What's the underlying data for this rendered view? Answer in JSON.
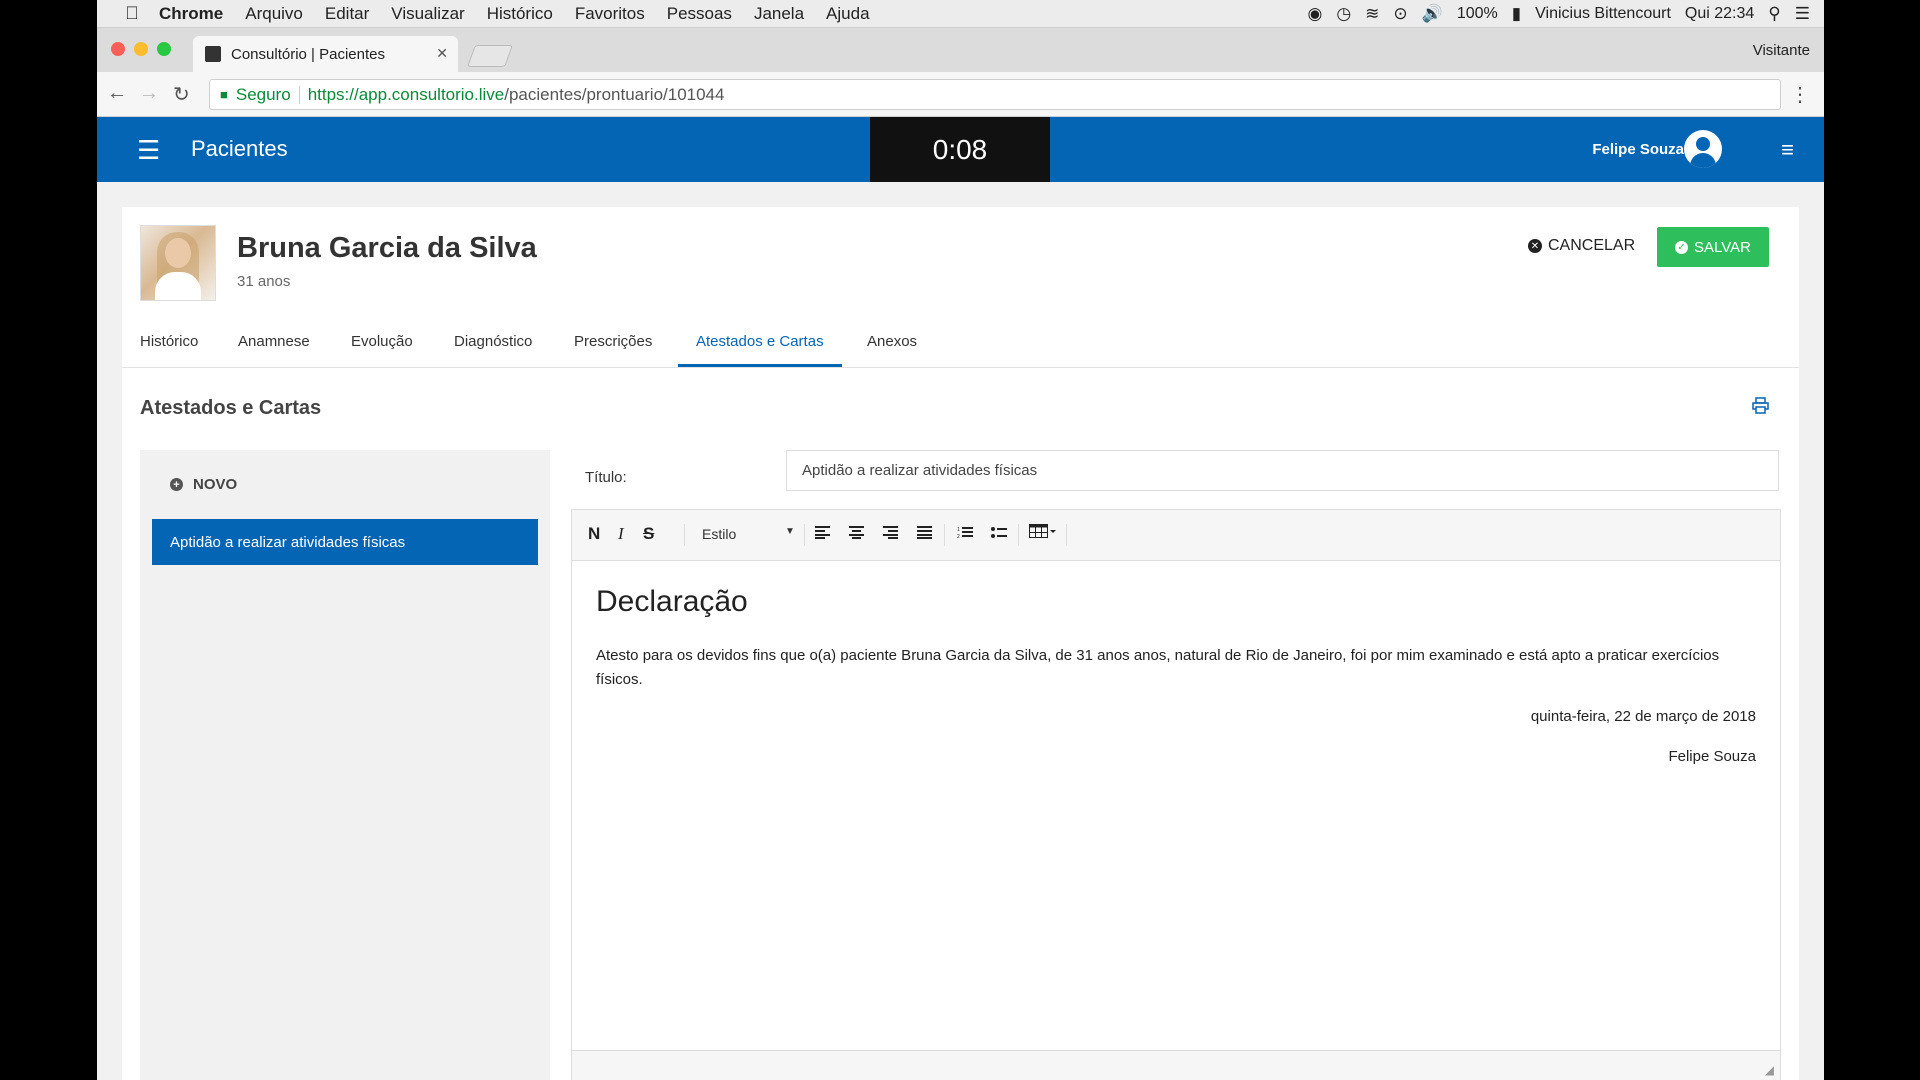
{
  "menubar": {
    "app": "Chrome",
    "items": [
      "Arquivo",
      "Editar",
      "Visualizar",
      "Histórico",
      "Favoritos",
      "Pessoas",
      "Janela",
      "Ajuda"
    ],
    "battery": "100%",
    "user": "Vinicius Bittencourt",
    "clock": "Qui 22:34"
  },
  "browser": {
    "tab_title": "Consultório | Pacientes",
    "profile": "Visitante",
    "secure_label": "Seguro",
    "url_host": "https://app.consultorio.live",
    "url_path": "/pacientes/prontuario/101044"
  },
  "app": {
    "section": "Pacientes",
    "timer": "0:08",
    "user_name": "Felipe Souza"
  },
  "patient": {
    "name": "Bruna Garcia da Silva",
    "age": "31 anos"
  },
  "actions": {
    "cancel": "CANCELAR",
    "save": "SALVAR"
  },
  "tabs": [
    {
      "label": "Histórico"
    },
    {
      "label": "Anamnese"
    },
    {
      "label": "Evolução"
    },
    {
      "label": "Diagnóstico"
    },
    {
      "label": "Prescrições"
    },
    {
      "label": "Atestados e Cartas",
      "active": true
    },
    {
      "label": "Anexos"
    }
  ],
  "section_title": "Atestados e Cartas",
  "left_panel": {
    "new_label": "NOVO",
    "documents": [
      "Aptidão a realizar atividades físicas"
    ]
  },
  "form": {
    "title_label": "Título:",
    "title_value": "Aptidão a realizar atividades físicas"
  },
  "editor": {
    "toolbar": {
      "bold": "N",
      "italic": "I",
      "strike": "S",
      "style": "Estilo"
    },
    "heading": "Declaração",
    "body": "Atesto para os devidos fins que o(a) paciente Bruna Garcia da Silva, de 31 anos anos, natural de Rio de Janeiro, foi por mim examinado e está apto a praticar exercícios físicos.",
    "date": "quinta-feira, 22 de março de 2018",
    "signer": "Felipe Souza"
  },
  "colors": {
    "primary": "#0565b5",
    "success": "#2ebf5c",
    "timer_bg": "#111111"
  }
}
